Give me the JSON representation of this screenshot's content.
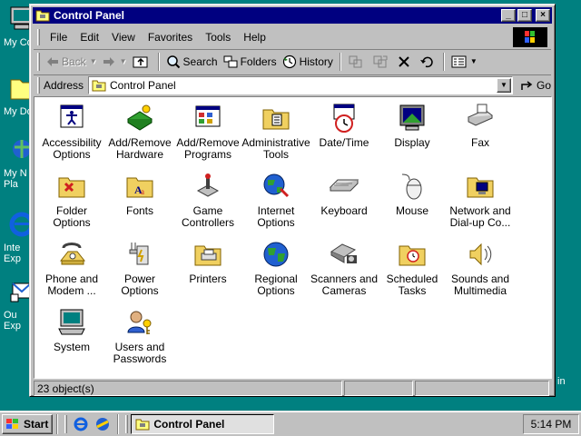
{
  "desktop": {
    "icons": [
      {
        "label": "My Co",
        "icon": "my-computer-icon"
      },
      {
        "label": "My Do",
        "icon": "my-documents-icon"
      },
      {
        "label": "My N",
        "label2": "Pla",
        "icon": "network-places-icon"
      },
      {
        "label": "Inte",
        "label2": "Exp",
        "icon": "internet-explorer-icon"
      },
      {
        "label": "Ou",
        "label2": "Exp",
        "icon": "outlook-express-icon"
      }
    ],
    "right_edge_text": "in"
  },
  "window": {
    "title": "Control Panel",
    "controls": {
      "minimize": "_",
      "maximize": "□",
      "close": "×"
    }
  },
  "menu": [
    "File",
    "Edit",
    "View",
    "Favorites",
    "Tools",
    "Help"
  ],
  "toolbar": {
    "back": "Back",
    "search": "Search",
    "folders": "Folders",
    "history": "History"
  },
  "address": {
    "label": "Address",
    "value": "Control Panel",
    "go": "Go"
  },
  "items": [
    {
      "label": "Accessibility Options",
      "icon": "accessibility-icon"
    },
    {
      "label": "Add/Remove Hardware",
      "icon": "add-remove-hardware-icon"
    },
    {
      "label": "Add/Remove Programs",
      "icon": "add-remove-programs-icon"
    },
    {
      "label": "Administrative Tools",
      "icon": "administrative-tools-icon"
    },
    {
      "label": "Date/Time",
      "icon": "date-time-icon"
    },
    {
      "label": "Display",
      "icon": "display-icon"
    },
    {
      "label": "Fax",
      "icon": "fax-icon"
    },
    {
      "label": "Folder Options",
      "icon": "folder-options-icon"
    },
    {
      "label": "Fonts",
      "icon": "fonts-icon"
    },
    {
      "label": "Game Controllers",
      "icon": "game-controllers-icon"
    },
    {
      "label": "Internet Options",
      "icon": "internet-options-icon"
    },
    {
      "label": "Keyboard",
      "icon": "keyboard-icon"
    },
    {
      "label": "Mouse",
      "icon": "mouse-icon"
    },
    {
      "label": "Network and Dial-up Co...",
      "icon": "network-dialup-icon"
    },
    {
      "label": "Phone and Modem ...",
      "icon": "phone-modem-icon"
    },
    {
      "label": "Power Options",
      "icon": "power-options-icon"
    },
    {
      "label": "Printers",
      "icon": "printers-icon"
    },
    {
      "label": "Regional Options",
      "icon": "regional-options-icon"
    },
    {
      "label": "Scanners and Cameras",
      "icon": "scanners-cameras-icon"
    },
    {
      "label": "Scheduled Tasks",
      "icon": "scheduled-tasks-icon"
    },
    {
      "label": "Sounds and Multimedia",
      "icon": "sounds-multimedia-icon"
    },
    {
      "label": "System",
      "icon": "system-icon"
    },
    {
      "label": "Users and Passwords",
      "icon": "users-passwords-icon"
    }
  ],
  "status": {
    "count": "23 object(s)"
  },
  "taskbar": {
    "start": "Start",
    "task": "Control Panel",
    "clock": "5:14 PM"
  },
  "colors": {
    "desktop": "#008080",
    "titlebar": "#000080",
    "face": "#c0c0c0"
  }
}
